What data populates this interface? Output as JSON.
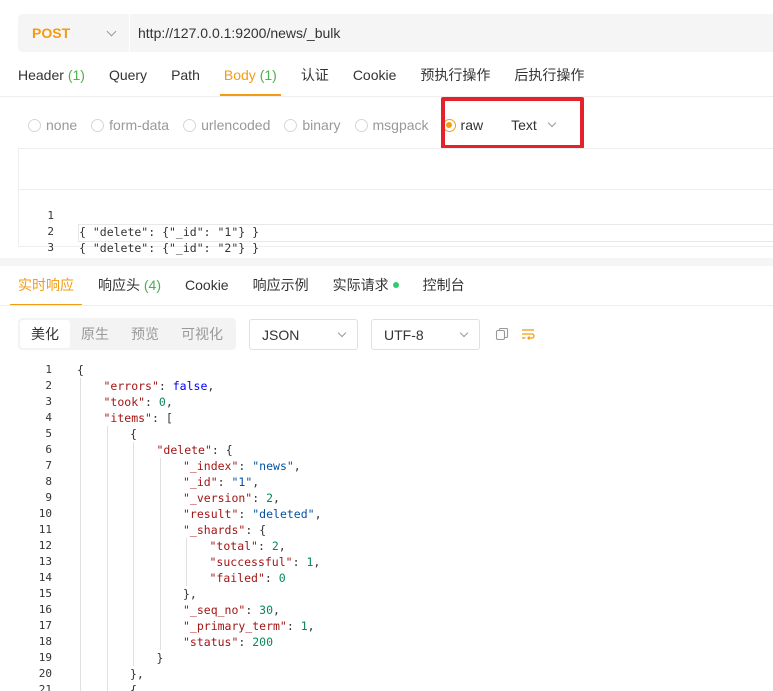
{
  "request": {
    "method": "POST",
    "url": "http://127.0.0.1:9200/news/_bulk"
  },
  "request_tabs": [
    {
      "label": "Header",
      "count": "(1)"
    },
    {
      "label": "Query",
      "count": ""
    },
    {
      "label": "Path",
      "count": ""
    },
    {
      "label": "Body",
      "count": "(1)"
    },
    {
      "label": "认证",
      "count": ""
    },
    {
      "label": "Cookie",
      "count": ""
    },
    {
      "label": "预执行操作",
      "count": ""
    },
    {
      "label": "后执行操作",
      "count": ""
    }
  ],
  "body_types": [
    "none",
    "form-data",
    "urlencoded",
    "binary",
    "msgpack",
    "raw"
  ],
  "raw_format": "Text",
  "request_body": [
    {
      "n": "1",
      "text": "{ \"delete\": {\"_id\": \"1\"} }"
    },
    {
      "n": "2",
      "text": "{ \"delete\": {\"_id\": \"2\"} }"
    },
    {
      "n": "3",
      "text": ""
    }
  ],
  "response_tabs": [
    {
      "label": "实时响应",
      "count": ""
    },
    {
      "label": "响应头",
      "count": "(4)"
    },
    {
      "label": "Cookie",
      "count": ""
    },
    {
      "label": "响应示例",
      "count": ""
    },
    {
      "label": "实际请求",
      "count": ""
    },
    {
      "label": "控制台",
      "count": ""
    }
  ],
  "view_modes": [
    "美化",
    "原生",
    "预览",
    "可视化"
  ],
  "format_select": "JSON",
  "encoding_select": "UTF-8",
  "colors": {
    "accent": "#f39c12",
    "count_green": "#4caf50",
    "highlight_red": "#e4222b",
    "status_dot": "#2ecc71"
  },
  "response_lines": [
    {
      "n": "1",
      "indent": 0,
      "parts": [
        {
          "t": "{",
          "c": "p"
        }
      ]
    },
    {
      "n": "2",
      "indent": 1,
      "parts": [
        {
          "t": "\"errors\"",
          "c": "key"
        },
        {
          "t": ": ",
          "c": "p"
        },
        {
          "t": "false",
          "c": "bool"
        },
        {
          "t": ",",
          "c": "p"
        }
      ]
    },
    {
      "n": "3",
      "indent": 1,
      "parts": [
        {
          "t": "\"took\"",
          "c": "key"
        },
        {
          "t": ": ",
          "c": "p"
        },
        {
          "t": "0",
          "c": "num"
        },
        {
          "t": ",",
          "c": "p"
        }
      ]
    },
    {
      "n": "4",
      "indent": 1,
      "parts": [
        {
          "t": "\"items\"",
          "c": "key"
        },
        {
          "t": ": [",
          "c": "p"
        }
      ]
    },
    {
      "n": "5",
      "indent": 2,
      "parts": [
        {
          "t": "{",
          "c": "p"
        }
      ]
    },
    {
      "n": "6",
      "indent": 3,
      "parts": [
        {
          "t": "\"delete\"",
          "c": "key"
        },
        {
          "t": ": {",
          "c": "p"
        }
      ]
    },
    {
      "n": "7",
      "indent": 4,
      "parts": [
        {
          "t": "\"_index\"",
          "c": "key"
        },
        {
          "t": ": ",
          "c": "p"
        },
        {
          "t": "\"news\"",
          "c": "str"
        },
        {
          "t": ",",
          "c": "p"
        }
      ]
    },
    {
      "n": "8",
      "indent": 4,
      "parts": [
        {
          "t": "\"_id\"",
          "c": "key"
        },
        {
          "t": ": ",
          "c": "p"
        },
        {
          "t": "\"1\"",
          "c": "str"
        },
        {
          "t": ",",
          "c": "p"
        }
      ]
    },
    {
      "n": "9",
      "indent": 4,
      "parts": [
        {
          "t": "\"_version\"",
          "c": "key"
        },
        {
          "t": ": ",
          "c": "p"
        },
        {
          "t": "2",
          "c": "num"
        },
        {
          "t": ",",
          "c": "p"
        }
      ]
    },
    {
      "n": "10",
      "indent": 4,
      "parts": [
        {
          "t": "\"result\"",
          "c": "key"
        },
        {
          "t": ": ",
          "c": "p"
        },
        {
          "t": "\"deleted\"",
          "c": "str"
        },
        {
          "t": ",",
          "c": "p"
        }
      ]
    },
    {
      "n": "11",
      "indent": 4,
      "parts": [
        {
          "t": "\"_shards\"",
          "c": "key"
        },
        {
          "t": ": {",
          "c": "p"
        }
      ]
    },
    {
      "n": "12",
      "indent": 5,
      "parts": [
        {
          "t": "\"total\"",
          "c": "key"
        },
        {
          "t": ": ",
          "c": "p"
        },
        {
          "t": "2",
          "c": "num"
        },
        {
          "t": ",",
          "c": "p"
        }
      ]
    },
    {
      "n": "13",
      "indent": 5,
      "parts": [
        {
          "t": "\"successful\"",
          "c": "key"
        },
        {
          "t": ": ",
          "c": "p"
        },
        {
          "t": "1",
          "c": "num"
        },
        {
          "t": ",",
          "c": "p"
        }
      ]
    },
    {
      "n": "14",
      "indent": 5,
      "parts": [
        {
          "t": "\"failed\"",
          "c": "key"
        },
        {
          "t": ": ",
          "c": "p"
        },
        {
          "t": "0",
          "c": "num"
        }
      ]
    },
    {
      "n": "15",
      "indent": 4,
      "parts": [
        {
          "t": "},",
          "c": "p"
        }
      ]
    },
    {
      "n": "16",
      "indent": 4,
      "parts": [
        {
          "t": "\"_seq_no\"",
          "c": "key"
        },
        {
          "t": ": ",
          "c": "p"
        },
        {
          "t": "30",
          "c": "num"
        },
        {
          "t": ",",
          "c": "p"
        }
      ]
    },
    {
      "n": "17",
      "indent": 4,
      "parts": [
        {
          "t": "\"_primary_term\"",
          "c": "key"
        },
        {
          "t": ": ",
          "c": "p"
        },
        {
          "t": "1",
          "c": "num"
        },
        {
          "t": ",",
          "c": "p"
        }
      ]
    },
    {
      "n": "18",
      "indent": 4,
      "parts": [
        {
          "t": "\"status\"",
          "c": "key"
        },
        {
          "t": ": ",
          "c": "p"
        },
        {
          "t": "200",
          "c": "num"
        }
      ]
    },
    {
      "n": "19",
      "indent": 3,
      "parts": [
        {
          "t": "}",
          "c": "p"
        }
      ]
    },
    {
      "n": "20",
      "indent": 2,
      "parts": [
        {
          "t": "},",
          "c": "p"
        }
      ]
    },
    {
      "n": "21",
      "indent": 2,
      "parts": [
        {
          "t": "{",
          "c": "p"
        }
      ]
    }
  ]
}
